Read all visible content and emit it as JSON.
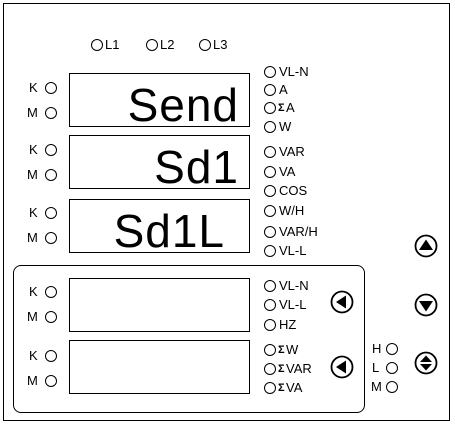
{
  "phase_leds": [
    "L1",
    "L2",
    "L3"
  ],
  "km_labels": {
    "k": "K",
    "m": "M"
  },
  "displays": [
    {
      "text": "Send"
    },
    {
      "text": "Sd1"
    },
    {
      "text": "Sd1L"
    },
    {
      "text": ""
    },
    {
      "text": ""
    }
  ],
  "unit_indicators_upper": [
    "VL-N",
    "A",
    "A",
    "W",
    "VAR",
    "VA",
    "COS",
    "W/H",
    "VAR/H",
    "VL-L"
  ],
  "unit_indicators_lower_1": [
    "VL-N",
    "VL-L",
    "HZ"
  ],
  "unit_indicators_lower_2": [
    "W",
    "VAR",
    "VA"
  ],
  "sigma_symbol": "Σ",
  "hl_labels": {
    "h": "H",
    "l": "L",
    "m": "M"
  },
  "icons": {
    "up_button": "triangle-up-icon",
    "down_button": "triangle-down-icon",
    "updown_button": "up-down-icon",
    "left_button_1": "triangle-left-icon",
    "left_button_2": "triangle-left-icon"
  }
}
